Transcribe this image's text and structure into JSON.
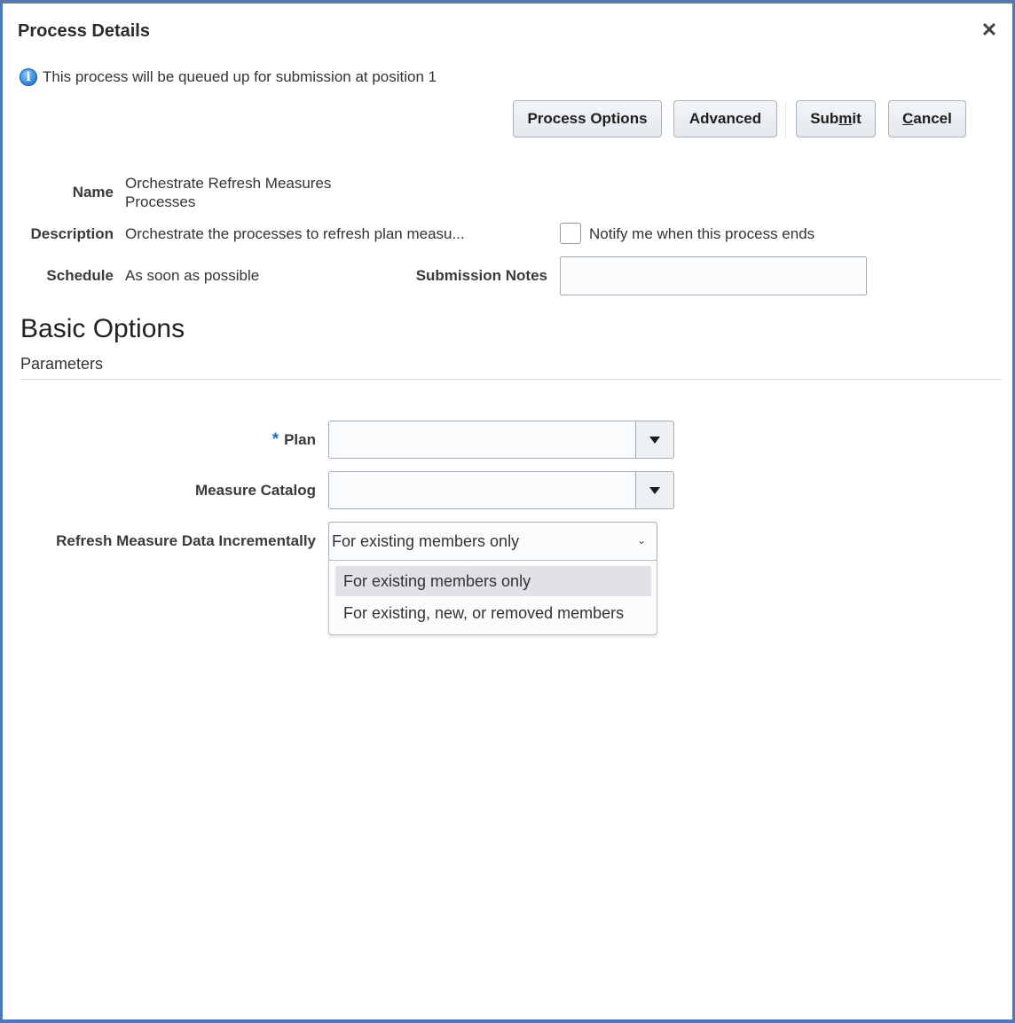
{
  "dialog": {
    "title": "Process Details",
    "close_icon": "close-icon",
    "info_icon": "info-icon",
    "info_message": "This process will be queued up for submission at position 1"
  },
  "toolbar": {
    "process_options_label": "Process Options",
    "advanced_label": "Advanced",
    "submit_label_pre": "Sub",
    "submit_label_mnemonic": "m",
    "submit_label_post": "it",
    "cancel_label_mnemonic": "C",
    "cancel_label_post": "ancel"
  },
  "details": {
    "name_label": "Name",
    "name_value_line1": "Orchestrate Refresh Measures",
    "name_value_line2": "Processes",
    "description_label": "Description",
    "description_value": "Orchestrate the processes to refresh plan measu...",
    "schedule_label": "Schedule",
    "schedule_value": "As soon as possible",
    "notify_label": "Notify me when this process ends",
    "notify_checked": false,
    "submission_notes_label": "Submission Notes",
    "submission_notes_value": ""
  },
  "section": {
    "title": "Basic Options",
    "subtitle": "Parameters"
  },
  "parameters": {
    "required_marker": "*",
    "plan_label": "Plan",
    "plan_value": "",
    "measure_catalog_label": "Measure Catalog",
    "measure_catalog_value": "",
    "refresh_label": "Refresh Measure Data Incrementally",
    "refresh_value": "For existing members only",
    "refresh_options": [
      {
        "label": "For existing members only",
        "selected": true
      },
      {
        "label": "For existing, new, or removed members",
        "selected": false
      }
    ]
  }
}
